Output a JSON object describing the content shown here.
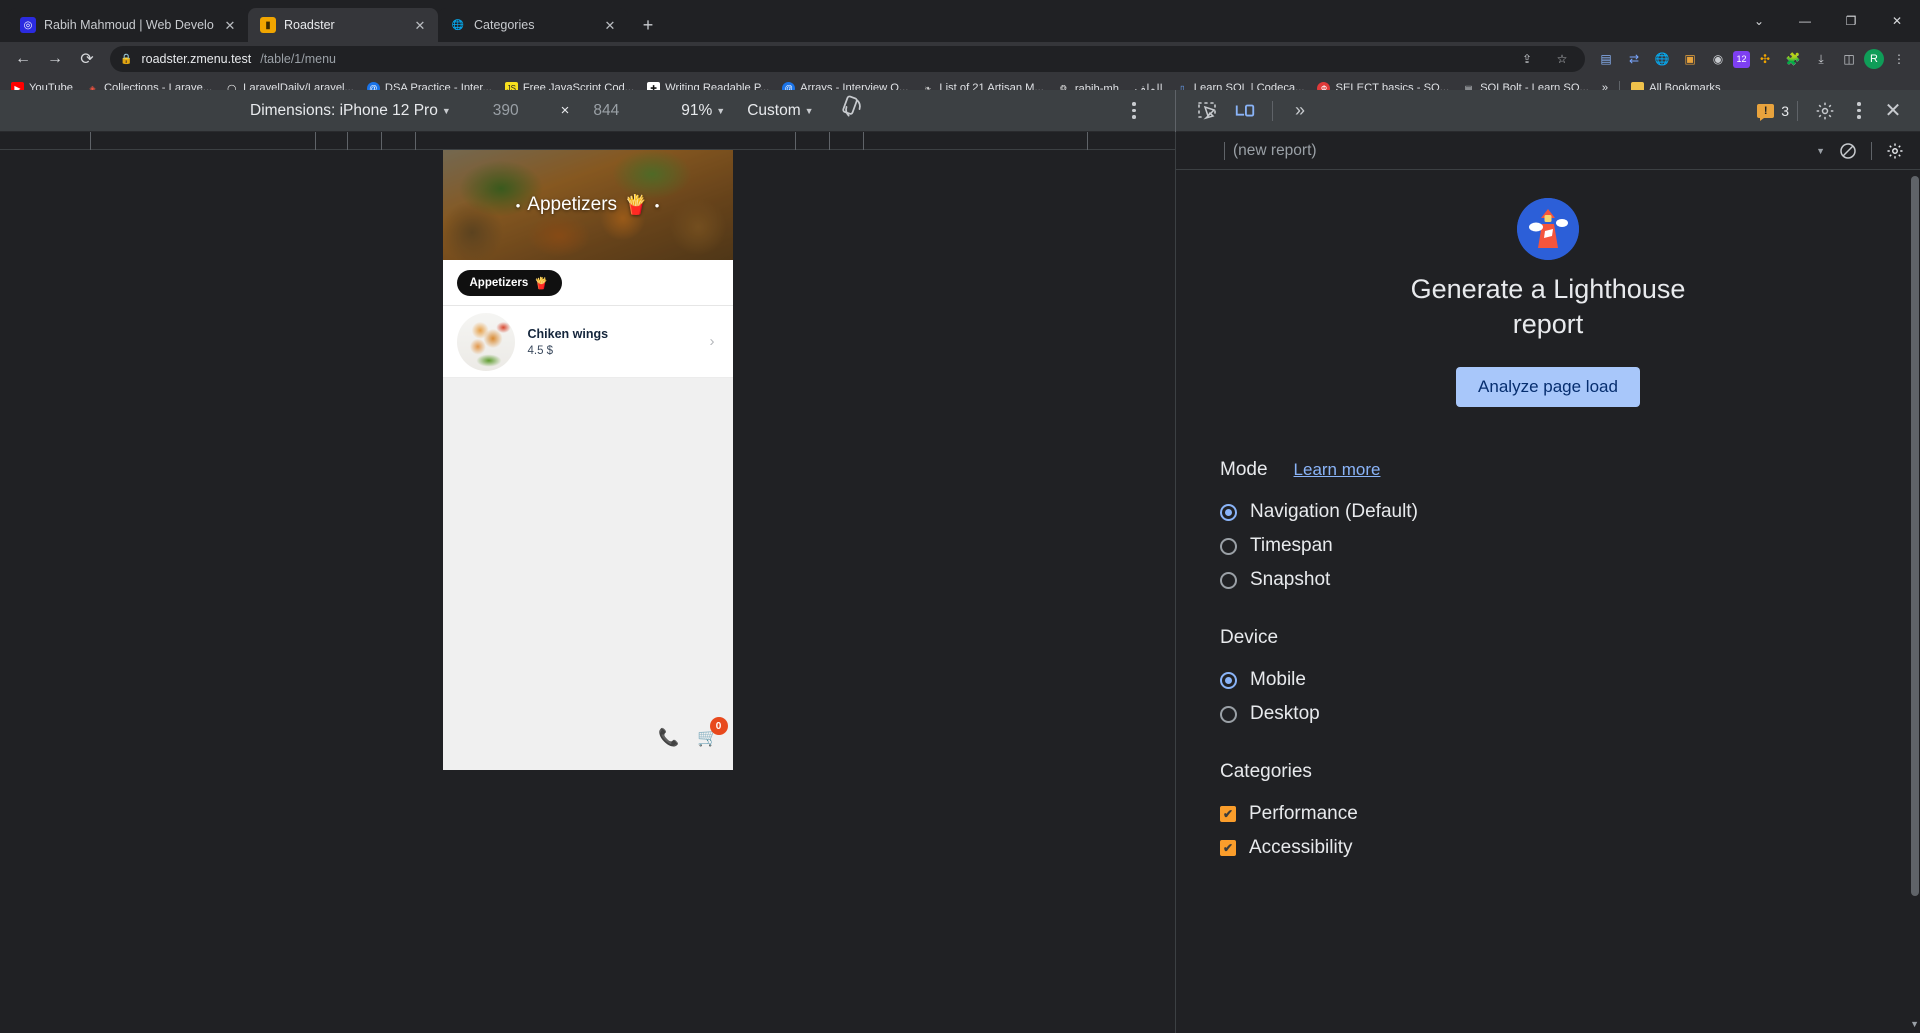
{
  "browser": {
    "tabs": [
      {
        "title": "Rabih Mahmoud | Web Develop",
        "active": false,
        "favicon": "site-icon",
        "close": "✕"
      },
      {
        "title": "Roadster",
        "active": true,
        "favicon": "roadster-icon",
        "close": "✕"
      },
      {
        "title": "Categories",
        "active": false,
        "favicon": "globe-icon",
        "close": "✕"
      }
    ],
    "new_tab_label": "+",
    "window_controls": [
      "⌄",
      "—",
      "❐",
      "✕"
    ],
    "nav": {
      "back": "←",
      "forward": "→",
      "reload": "⟳"
    },
    "omnibox": {
      "lock_icon": "lock-icon",
      "url_host": "roadster.zmenu.test",
      "url_path": "/table/1/menu",
      "share_icon": "share-icon",
      "star_icon": "star-icon"
    },
    "toolbar_icons": [
      "extension-grid-icon",
      "translate-icon",
      "globe-icon",
      "image-icon",
      "record-icon",
      "shield-12-icon",
      "puzzle-color-icon",
      "puzzle-icon",
      "download-icon",
      "sidepanel-icon",
      "profile-avatar"
    ],
    "bookmarks": [
      {
        "label": "YouTube",
        "icon": "youtube-icon",
        "color": "#ff0000"
      },
      {
        "label": "Collections - Larave...",
        "icon": "laravel-icon",
        "color": "#f05340"
      },
      {
        "label": "LaravelDaily/Laravel...",
        "icon": "github-icon",
        "color": "#ffffff"
      },
      {
        "label": "DSA Practice - Inter...",
        "icon": "at-icon",
        "color": "#1a73e8"
      },
      {
        "label": "Free JavaScript Cod...",
        "icon": "js-icon",
        "color": "#f7df1e"
      },
      {
        "label": "Writing Readable P...",
        "icon": "plus-icon",
        "color": "#ffffff"
      },
      {
        "label": "Arrays - Interview Q...",
        "icon": "at-icon",
        "color": "#1a73e8"
      },
      {
        "label": "List of 21 Artisan M...",
        "icon": "dev-icon",
        "color": "#cccccc"
      },
      {
        "label": "rabih-mh ... الملف",
        "icon": "doc-icon",
        "color": "#dddddd"
      },
      {
        "label": "Learn SQL | Codeca...",
        "icon": "codecademy-icon",
        "color": "#6da7ff"
      },
      {
        "label": "SELECT basics - SQ...",
        "icon": "sql-icon",
        "color": "#e03a3a"
      },
      {
        "label": "SQLBolt - Learn SQ...",
        "icon": "bolt-icon",
        "color": "#cfd2d6"
      }
    ],
    "bookmarks_overflow": "»",
    "all_bookmarks": {
      "label": "All Bookmarks",
      "icon": "folder-icon"
    }
  },
  "devtools": {
    "device_toolbar": {
      "dimensions_label": "Dimensions: iPhone 12 Pro",
      "caret": "▼",
      "width": "390",
      "times": "×",
      "height": "844",
      "zoom": "91%",
      "zoom_caret": "▼",
      "throttling": "Custom",
      "throttling_caret": "▼",
      "rotate_icon": "rotate-device-icon",
      "more_icon": "kebab-menu-icon"
    },
    "panel_icons": {
      "inspect": "inspect-element-icon",
      "device_toggle": "device-toolbar-icon",
      "more_tabs": "»",
      "warning_count": "3",
      "warning_icon": "warning-icon",
      "settings": "gear-icon",
      "kebab": "kebab-menu-icon",
      "close": "close-icon"
    }
  },
  "lighthouse": {
    "toolbar": {
      "add_icon": "plus-icon",
      "report_select": "(new report)",
      "select_caret": "▼",
      "clear_icon": "clear-icon",
      "settings_icon": "gear-icon"
    },
    "logo": "lighthouse-logo",
    "title": "Generate a Lighthouse report",
    "cta_label": "Analyze page load",
    "mode": {
      "title": "Mode",
      "learn_more": "Learn more",
      "options": [
        {
          "label": "Navigation (Default)",
          "selected": true
        },
        {
          "label": "Timespan",
          "selected": false
        },
        {
          "label": "Snapshot",
          "selected": false
        }
      ]
    },
    "device": {
      "title": "Device",
      "options": [
        {
          "label": "Mobile",
          "selected": true
        },
        {
          "label": "Desktop",
          "selected": false
        }
      ]
    },
    "categories": {
      "title": "Categories",
      "options": [
        {
          "label": "Performance",
          "checked": true
        },
        {
          "label": "Accessibility",
          "checked": true
        }
      ],
      "check_glyph": "✔"
    },
    "accent_blue": "#8ab4f8",
    "accent_orange": "#fa9d2b"
  },
  "page": {
    "hero": {
      "left_dot": "•",
      "title": "Appetizers",
      "emoji": "🍟",
      "right_dot": "•"
    },
    "chip": {
      "label": "Appetizers",
      "emoji": "🍟"
    },
    "item": {
      "name": "Chiken wings",
      "price": "4.5 $",
      "chevron": "›",
      "thumb": "chicken-wings-photo"
    },
    "footer": {
      "phone_icon": "phone-icon",
      "cart_icon": "cart-icon",
      "cart_count": "0"
    }
  }
}
